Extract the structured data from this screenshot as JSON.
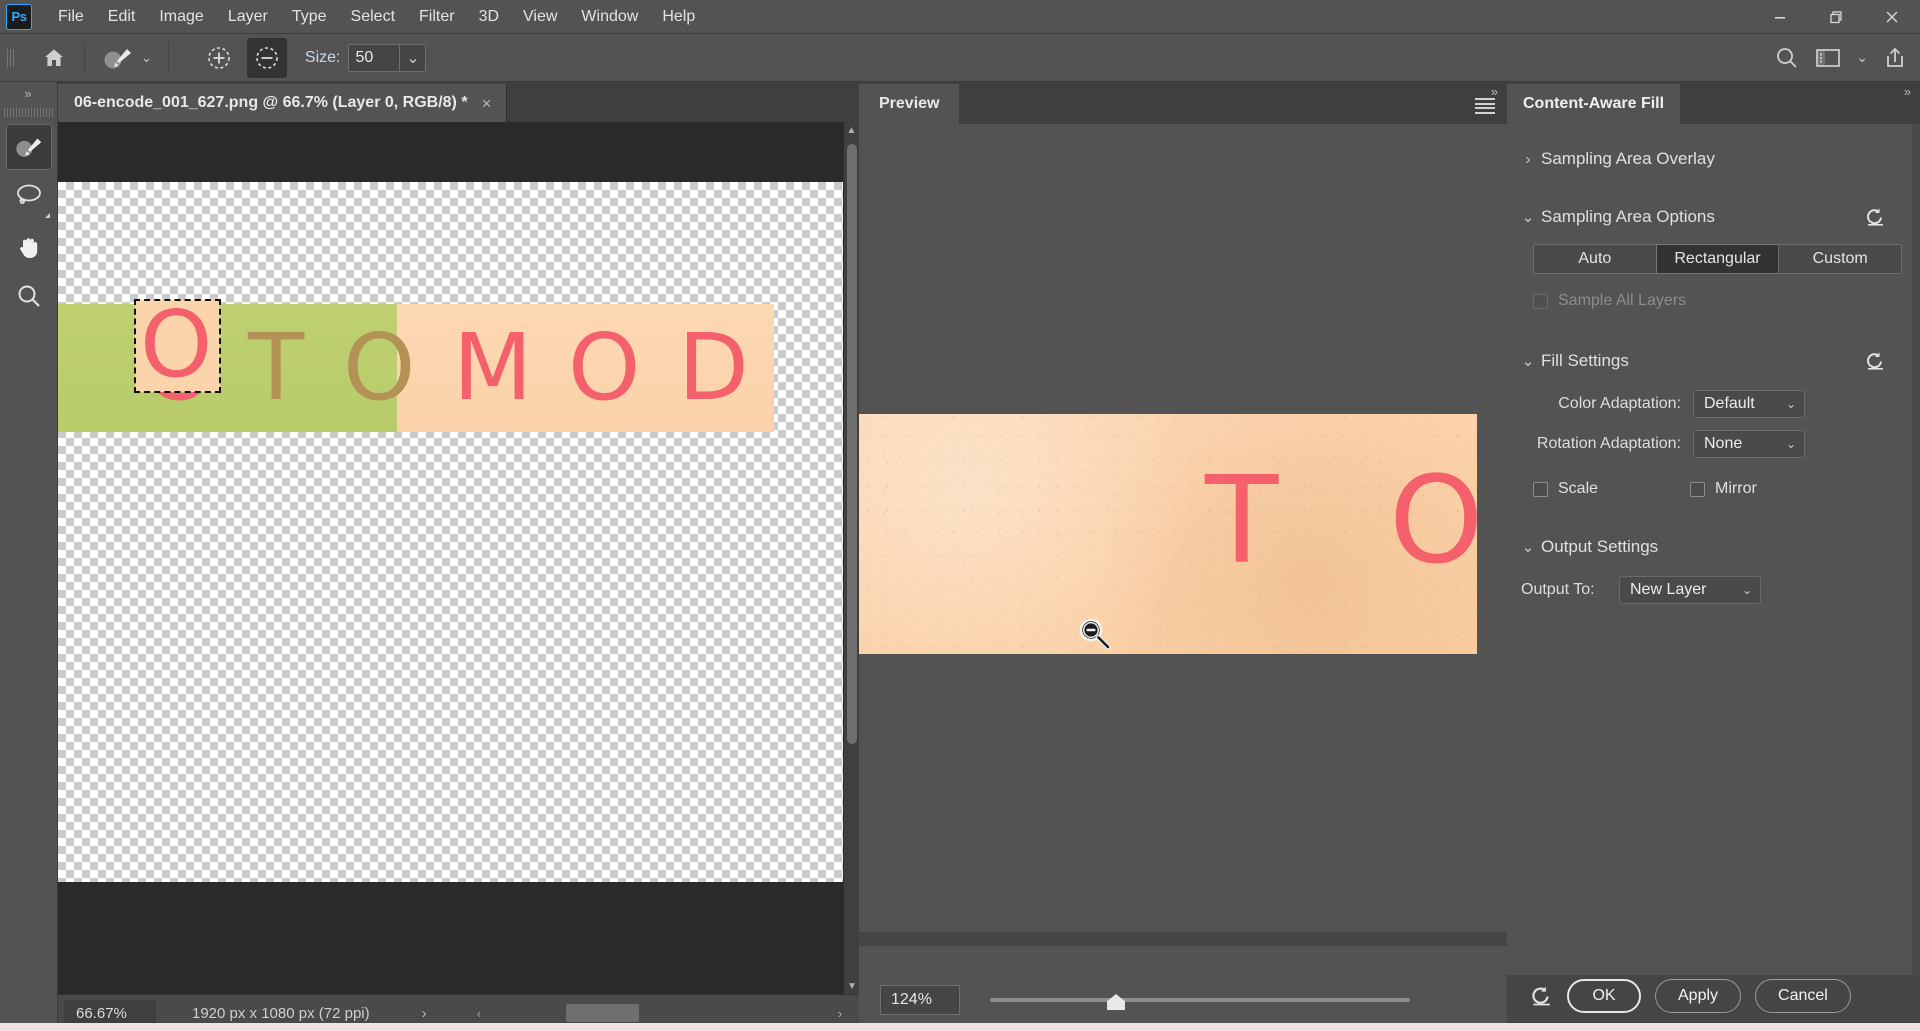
{
  "app": {
    "logo": "Ps",
    "menus": [
      "File",
      "Edit",
      "Image",
      "Layer",
      "Type",
      "Select",
      "Filter",
      "3D",
      "View",
      "Window",
      "Help"
    ],
    "window_controls": {
      "minimize": "minimize-icon",
      "restore": "restore-icon",
      "close": "close-icon"
    }
  },
  "options_bar": {
    "home_icon": "home-icon",
    "tool_preset_icon": "sampling-brush-icon",
    "tool_preset_caret": "chevron-down-icon",
    "add_icon": "add-to-sampling-area-icon",
    "subtract_icon": "subtract-from-sampling-area-icon",
    "size_label": "Size:",
    "size_value": "50",
    "size_caret": "chevron-down-icon",
    "search_icon": "search-icon",
    "workspace_icon": "workspace-switcher-icon",
    "workspace_caret": "chevron-down-icon",
    "share_icon": "share-icon"
  },
  "toolstrip": {
    "collapse_icon": "double-chevron-right-icon",
    "tools": [
      {
        "name": "sampling-brush-tool",
        "icon": "sampling-brush-icon",
        "active": true
      },
      {
        "name": "lasso-tool",
        "icon": "lasso-icon",
        "active": false
      },
      {
        "name": "hand-tool",
        "icon": "hand-icon",
        "active": false
      },
      {
        "name": "zoom-tool",
        "icon": "magnifier-icon",
        "active": false
      }
    ]
  },
  "document": {
    "tab_title": "06-encode_001_627.png @ 66.7% (Layer 0, RGB/8) *",
    "tab_close_icon": "close-icon",
    "canvas": {
      "letters": [
        "O",
        "T",
        "O",
        "M",
        "O",
        "D"
      ],
      "selected_letter": "O",
      "green_color": "#bed071",
      "peach_color": "#fbd2a8",
      "red_letter_color": "#f4606b",
      "olive_letter_color": "#b39355"
    },
    "status": {
      "zoom": "66.67%",
      "dimensions": "1920 px x 1080 px (72 ppi)",
      "expand_icon": "chevron-right-icon",
      "scroll_left_icon": "chevron-left-icon",
      "scroll_right_icon": "chevron-right-icon"
    }
  },
  "preview_panel": {
    "collapse_icon": "double-chevron-right-icon",
    "tab_label": "Preview",
    "menu_icon": "panel-menu-icon",
    "image_letters": [
      "T",
      "O"
    ],
    "cursor_icon": "zoom-out-cursor-icon",
    "zoom_value": "124%",
    "zoom_slider_percent": 30
  },
  "caf_panel": {
    "collapse_icon": "double-chevron-right-icon",
    "tab_label": "Content-Aware Fill",
    "sections": {
      "sampling_area_overlay": {
        "title": "Sampling Area Overlay",
        "expanded": false,
        "chevron": "chevron-right-icon"
      },
      "sampling_area_options": {
        "title": "Sampling Area Options",
        "expanded": true,
        "chevron": "chevron-down-icon",
        "reset_icon": "reset-icon",
        "modes": [
          "Auto",
          "Rectangular",
          "Custom"
        ],
        "selected_mode": "Rectangular",
        "sample_all_layers_label": "Sample All Layers",
        "sample_all_layers_checked": false,
        "sample_all_layers_disabled": true
      },
      "fill_settings": {
        "title": "Fill Settings",
        "expanded": true,
        "chevron": "chevron-down-icon",
        "reset_icon": "reset-icon",
        "color_adaptation_label": "Color Adaptation:",
        "color_adaptation_value": "Default",
        "rotation_adaptation_label": "Rotation Adaptation:",
        "rotation_adaptation_value": "None",
        "scale_label": "Scale",
        "scale_checked": false,
        "mirror_label": "Mirror",
        "mirror_checked": false
      },
      "output_settings": {
        "title": "Output Settings",
        "expanded": true,
        "chevron": "chevron-down-icon",
        "output_to_label": "Output To:",
        "output_to_value": "New Layer"
      }
    },
    "footer": {
      "reset_icon": "reset-icon",
      "ok_label": "OK",
      "apply_label": "Apply",
      "cancel_label": "Cancel"
    }
  },
  "colors": {
    "chrome": "#535353",
    "panel": "#454545",
    "canvas_bg": "#2a2a2a",
    "accent_blue": "#31a8ff",
    "text": "#e8e8e8"
  }
}
